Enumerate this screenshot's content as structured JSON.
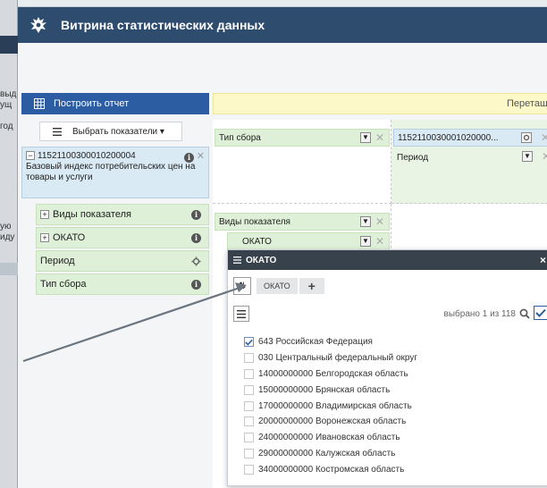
{
  "app": {
    "title": "Витрина статистических данных"
  },
  "left": {
    "build_button": "Построить отчет",
    "choose_button": "Выбрать показатели ▾",
    "indicator": {
      "code": "11521100300010200004",
      "name": "Базовый индекс потребительских цен на товары и услуги"
    },
    "dimensions": [
      {
        "label": "Виды показателя",
        "expandable": true,
        "icon": "info-icon"
      },
      {
        "label": "ОКАТО",
        "expandable": true,
        "icon": "info-icon"
      },
      {
        "label": "Период",
        "expandable": false,
        "icon": "gear-icon"
      },
      {
        "label": "Тип сбора",
        "expandable": false,
        "icon": "info-icon"
      }
    ]
  },
  "pivot": {
    "drop_hint": "Перетащ",
    "filters": [
      {
        "label": "Тип сбора"
      }
    ],
    "columns": [
      {
        "label": "1152110030001020000..."
      },
      {
        "label": "Период"
      }
    ],
    "rows": [
      {
        "label": "Виды показателя"
      },
      {
        "label": "ОКАТО"
      }
    ]
  },
  "popup": {
    "title": "ОКАТО",
    "crumb": "ОКАТО",
    "add": "+",
    "selected_text": "выбрано 1 из 118",
    "items": [
      {
        "label": "643 Российская Федерация",
        "checked": true
      },
      {
        "label": "030 Центральный федеральный округ",
        "checked": false
      },
      {
        "label": "14000000000 Белгородская область",
        "checked": false
      },
      {
        "label": "15000000000 Брянская область",
        "checked": false
      },
      {
        "label": "17000000000 Владимирская область",
        "checked": false
      },
      {
        "label": "20000000000 Воронежская область",
        "checked": false
      },
      {
        "label": "24000000000 Ивановская область",
        "checked": false
      },
      {
        "label": "29000000000 Калужская область",
        "checked": false
      },
      {
        "label": "34000000000 Костромская область",
        "checked": false
      }
    ]
  },
  "background_window": {
    "labels": [
      "выд",
      "ущ",
      "год",
      "ую",
      "иду"
    ]
  },
  "colors": {
    "header": "#2e4c6e",
    "primary": "#2c5da3",
    "dimension_bg": "#dff0d8",
    "indicator_bg": "#d9eaf5",
    "hint_bg": "#fcf8c8"
  }
}
